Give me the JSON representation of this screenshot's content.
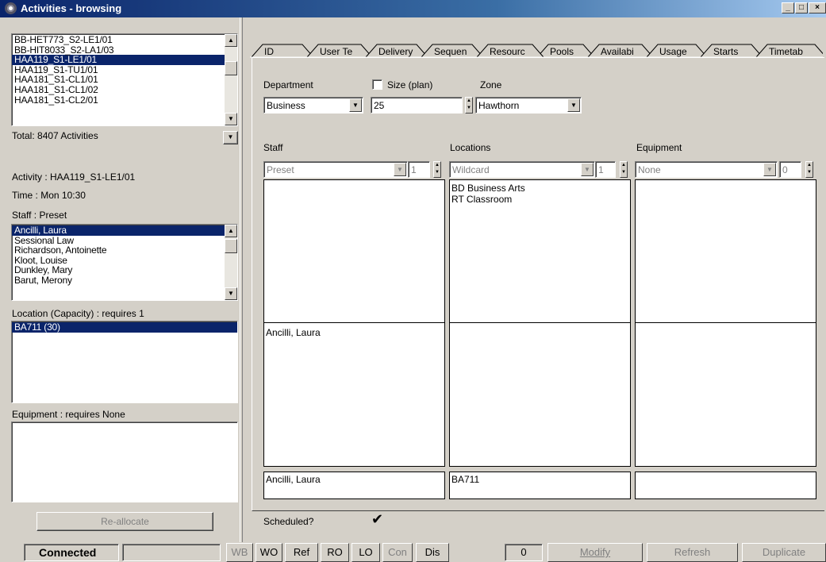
{
  "window": {
    "title": "Activities - browsing"
  },
  "activities": {
    "items": [
      "BB-HET773_S2-LE1/01",
      "BB-HIT8033_S2-LA1/03",
      "HAA119_S1-LE1/01",
      "HAA119_S1-TU1/01",
      "HAA181_S1-CL1/01",
      "HAA181_S1-CL1/02",
      "HAA181_S1-CL2/01"
    ],
    "selected_index": 2,
    "total": "Total: 8407 Activities"
  },
  "details": {
    "activity": "Activity : HAA119_S1-LE1/01",
    "time": "Time : Mon 10:30",
    "staff_label": "Staff : Preset",
    "staff_items": [
      "Ancilli, Laura",
      "Sessional Law",
      "Richardson, Antoinette",
      "Kloot, Louise",
      "Dunkley, Mary",
      "Barut, Merony"
    ],
    "location_label": "Location (Capacity) : requires 1",
    "location_items": [
      "BA711 (30)"
    ],
    "equipment_label": "Equipment : requires None",
    "reallocate": "Re-allocate"
  },
  "tabs": [
    "ID",
    "User Te",
    "Delivery",
    "Sequen",
    "Resourc",
    "Pools",
    "Availabi",
    "Usage",
    "Starts",
    "Timetab"
  ],
  "active_tab": "Resourc",
  "resources": {
    "department_label": "Department",
    "department_value": "Business",
    "size_label": "Size (plan)",
    "size_value": "25",
    "zone_label": "Zone",
    "zone_value": "Hawthorn",
    "staff_label": "Staff",
    "staff_select": "Preset",
    "staff_count": "1",
    "locations_label": "Locations",
    "locations_select": "Wildcard",
    "locations_count": "1",
    "equipment_label": "Equipment",
    "equipment_select": "None",
    "equipment_count": "0",
    "locations_list": [
      "BD Business Arts",
      "RT Classroom"
    ],
    "staff_assigned": "Ancilli, Laura",
    "staff_final": "Ancilli, Laura",
    "location_final": "BA711",
    "scheduled_label": "Scheduled?",
    "scheduled_mark": "✔"
  },
  "statusbar": {
    "connected": "Connected",
    "buttons": [
      "WB",
      "WO",
      "Ref",
      "RO",
      "LO",
      "Con",
      "Dis"
    ],
    "count": "0",
    "modify": "Modify",
    "refresh": "Refresh",
    "duplicate": "Duplicate"
  }
}
